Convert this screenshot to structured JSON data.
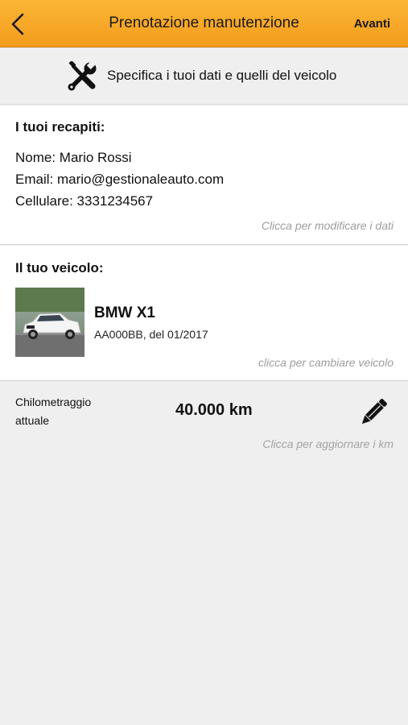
{
  "navbar": {
    "back_icon": "chevron-left-icon",
    "title": "Prenotazione manutenzione",
    "next_label": "Avanti"
  },
  "hint": {
    "icon": "tools-icon",
    "text": "Specifica i tuoi dati e quelli del veicolo"
  },
  "contacts": {
    "title": "I tuoi recapiti:",
    "name_line": "Nome: Mario Rossi",
    "email_line": "Email: mario@gestionaleauto.com",
    "phone_line": "Cellulare: 3331234567",
    "edit_hint": "Clicca per modificare i dati"
  },
  "vehicle": {
    "title": "Il tuo veicolo:",
    "name": "BMW X1",
    "details": "AA000BB, del 01/2017",
    "change_hint": "clicca per cambiare veicolo"
  },
  "mileage": {
    "label": "Chilometraggio attuale",
    "value": "40.000 km",
    "icon": "pencil-icon",
    "update_hint": "Clicca per aggiornare i km"
  },
  "colors": {
    "navbar": "#f7a828",
    "background": "#efefef",
    "hint_text": "#9d9d9d"
  }
}
